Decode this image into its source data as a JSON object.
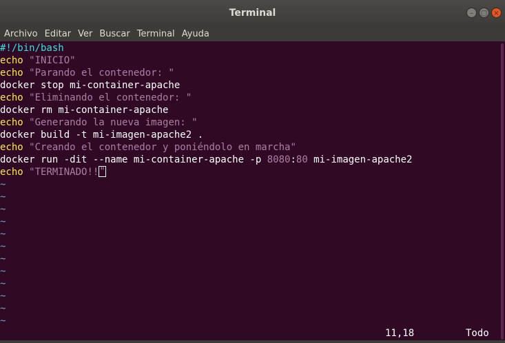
{
  "window": {
    "title": "Terminal"
  },
  "window_buttons": {
    "minimize": "–",
    "maximize": "□",
    "close": "×"
  },
  "menu": [
    "Archivo",
    "Editar",
    "Ver",
    "Buscar",
    "Terminal",
    "Ayuda"
  ],
  "editor": {
    "lines": [
      [
        {
          "t": "#!/bin/bash",
          "c": "shebang"
        }
      ],
      [
        {
          "t": "echo",
          "c": "kw"
        },
        {
          "t": " "
        },
        {
          "t": "\"INICIO\"",
          "c": "str"
        }
      ],
      [
        {
          "t": "echo",
          "c": "kw"
        },
        {
          "t": " "
        },
        {
          "t": "\"Parando el contenedor: \"",
          "c": "str"
        }
      ],
      [
        {
          "t": "docker stop mi-container-apache"
        }
      ],
      [
        {
          "t": "echo",
          "c": "kw"
        },
        {
          "t": " "
        },
        {
          "t": "\"Eliminando el contenedor: \"",
          "c": "str"
        }
      ],
      [
        {
          "t": "docker rm mi-container-apache"
        }
      ],
      [
        {
          "t": "echo",
          "c": "kw"
        },
        {
          "t": " "
        },
        {
          "t": "\"Generando la nueva imagen: \"",
          "c": "str"
        }
      ],
      [
        {
          "t": "docker build -t mi-imagen-apache2 ."
        }
      ],
      [
        {
          "t": "echo",
          "c": "kw"
        },
        {
          "t": " "
        },
        {
          "t": "\"Creando el contenedor y poniéndolo en marcha\"",
          "c": "str"
        }
      ],
      [
        {
          "t": "docker run -dit --name mi-container-apache -p "
        },
        {
          "t": "8080",
          "c": "num"
        },
        {
          "t": ":"
        },
        {
          "t": "80",
          "c": "num"
        },
        {
          "t": " mi-imagen-apache2"
        }
      ],
      [
        {
          "t": "echo",
          "c": "kw"
        },
        {
          "t": " "
        },
        {
          "t": "\"TERMINADO!!",
          "c": "str"
        },
        {
          "t": "\"",
          "c": "str",
          "cursor": true
        }
      ]
    ],
    "empty_line_marker": "~",
    "empty_line_count": 12
  },
  "status": {
    "cursor_position": "11,18",
    "scroll_position": "Todo"
  },
  "colors": {
    "background": "#300a24",
    "titlebar": "#3c3b37",
    "keyword": "#fce94f",
    "string": "#ad7fa8",
    "shebang": "#34e2e2",
    "tilde": "#729fcf",
    "close_button": "#e95420"
  }
}
